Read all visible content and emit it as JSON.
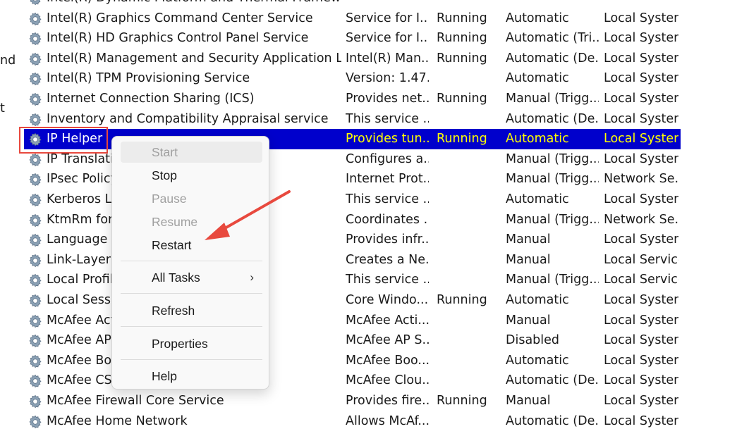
{
  "left_edge": [
    "nd",
    "t"
  ],
  "services": [
    {
      "name": "Intel(R) Dynamic Platform and Thermal Framework ...",
      "description": "",
      "status": "",
      "startup": "",
      "logon": ""
    },
    {
      "name": "Intel(R) Graphics Command Center Service",
      "description": "Service for I...",
      "status": "Running",
      "startup": "Automatic",
      "logon": "Local System"
    },
    {
      "name": "Intel(R) HD Graphics Control Panel Service",
      "description": "Service for I...",
      "status": "Running",
      "startup": "Automatic (Tri...",
      "logon": "Local System"
    },
    {
      "name": "Intel(R) Management and Security Application Loca...",
      "description": "Intel(R) Man...",
      "status": "Running",
      "startup": "Automatic (De...",
      "logon": "Local System"
    },
    {
      "name": "Intel(R) TPM Provisioning Service",
      "description": "Version: 1.47....",
      "status": "",
      "startup": "Automatic",
      "logon": "Local System"
    },
    {
      "name": "Internet Connection Sharing (ICS)",
      "description": "Provides net...",
      "status": "Running",
      "startup": "Manual (Trigg...",
      "logon": "Local System"
    },
    {
      "name": "Inventory and Compatibility Appraisal service",
      "description": "This service ...",
      "status": "",
      "startup": "Automatic (De...",
      "logon": "Local System"
    },
    {
      "name": "IP Helper",
      "description": "Provides tun...",
      "status": "Running",
      "startup": "Automatic",
      "logon": "Local System",
      "selected": true
    },
    {
      "name": "IP Translati",
      "description": "Configures a...",
      "status": "",
      "startup": "Manual (Trigg...",
      "logon": "Local System"
    },
    {
      "name": "IPsec Policy",
      "description": "Internet Prot...",
      "status": "",
      "startup": "Manual (Trigg...",
      "logon": "Network Se..."
    },
    {
      "name": "Kerberos Lo",
      "description": "This service ...",
      "status": "",
      "startup": "Automatic",
      "logon": "Local System"
    },
    {
      "name": "KtmRm for                                    dinator",
      "description": "Coordinates ...",
      "status": "",
      "startup": "Manual (Trigg...",
      "logon": "Network Se..."
    },
    {
      "name": "Language E",
      "description": "Provides infr...",
      "status": "",
      "startup": "Manual",
      "logon": "Local System"
    },
    {
      "name": "Link-Layer T",
      "description": "Creates a Ne...",
      "status": "",
      "startup": "Manual",
      "logon": "Local Service"
    },
    {
      "name": "Local Profile",
      "description": "This service ...",
      "status": "",
      "startup": "Manual (Trigg...",
      "logon": "Local Service"
    },
    {
      "name": "Local Sessio",
      "description": "Core Windo...",
      "status": "Running",
      "startup": "Automatic",
      "logon": "Local System"
    },
    {
      "name": "McAfee Acti",
      "description": "McAfee Acti...",
      "status": "",
      "startup": "Manual",
      "logon": "Local System"
    },
    {
      "name": "McAfee AP S",
      "description": "McAfee AP S...",
      "status": "",
      "startup": "Disabled",
      "logon": "Local System"
    },
    {
      "name": "McAfee Boo",
      "description": "McAfee Boo...",
      "status": "",
      "startup": "Automatic",
      "logon": "Local System"
    },
    {
      "name": "McAfee CSP",
      "description": "McAfee Clou...",
      "status": "",
      "startup": "Automatic (De...",
      "logon": "Local System"
    },
    {
      "name": "McAfee Firewall Core Service",
      "description": "Provides fire...",
      "status": "Running",
      "startup": "Manual",
      "logon": "Local System"
    },
    {
      "name": "McAfee Home Network",
      "description": "Allows McAf...",
      "status": "",
      "startup": "Automatic (De...",
      "logon": "Local System"
    }
  ],
  "context_menu": {
    "items": [
      {
        "label": "Start",
        "disabled": true
      },
      {
        "label": "Stop",
        "disabled": false
      },
      {
        "label": "Pause",
        "disabled": true
      },
      {
        "label": "Resume",
        "disabled": true
      },
      {
        "label": "Restart",
        "disabled": false
      },
      {
        "label": "All Tasks",
        "disabled": false,
        "submenu_arrow": "›"
      },
      {
        "label": "Refresh",
        "disabled": false
      },
      {
        "label": "Properties",
        "disabled": false
      },
      {
        "label": "Help",
        "disabled": false
      }
    ]
  },
  "colors": {
    "selection": "#0000cc",
    "selection_text": "#ffff00",
    "annotation_red": "#e8493e"
  },
  "icons": {
    "service": "gear-icon",
    "submenu": "chevron-right-icon",
    "annotation": "red-arrow"
  }
}
